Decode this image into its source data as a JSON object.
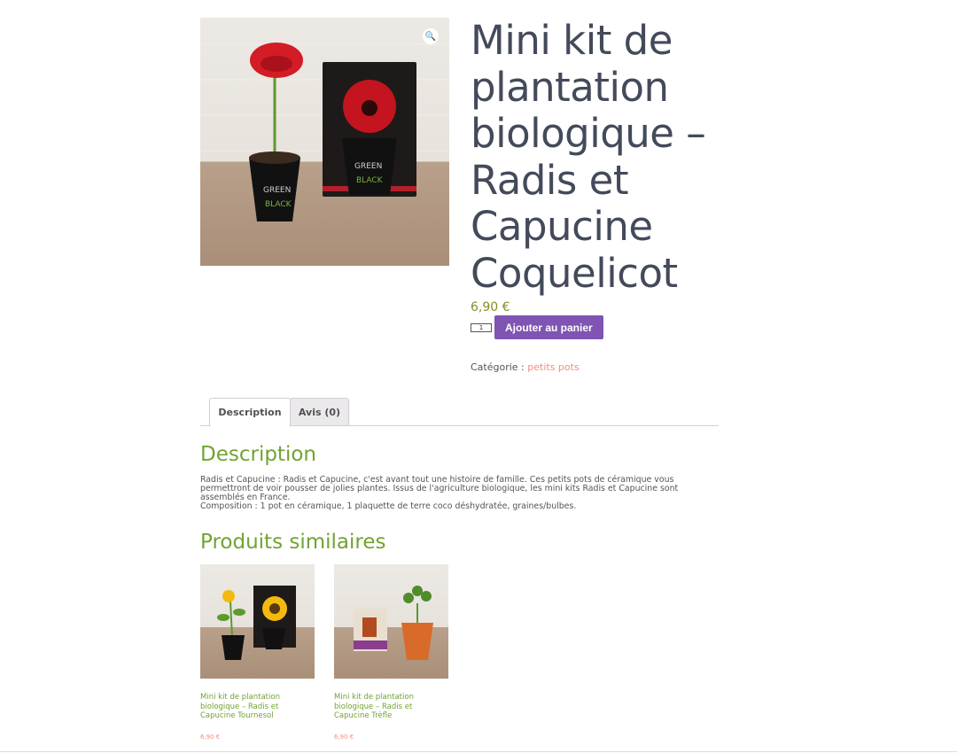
{
  "product": {
    "title": "Mini kit de plantation biologique – Radis et Capucine Coquelicot",
    "price": "6,90 €",
    "quantity": "1",
    "add_to_cart_label": "Ajouter au panier",
    "category_label": "Catégorie :",
    "category_value": "petits pots"
  },
  "gallery": {
    "zoom_icon": "🔍"
  },
  "tabs": [
    {
      "label": "Description"
    },
    {
      "label": "Avis (0)"
    }
  ],
  "description": {
    "heading": "Description",
    "line1": "Radis et Capucine : Radis et Capucine, c'est avant tout une histoire de famille. Ces petits pots de céramique vous permettront de voir pousser de jolies plantes. Issus de l'agriculture biologique, les mini kits Radis et Capucine sont assemblés en France.",
    "line2": "Composition : 1 pot en céramique, 1 plaquette de terre coco déshydratée, graines/bulbes."
  },
  "related": {
    "heading": "Produits similaires",
    "items": [
      {
        "name": "Mini kit de plantation biologique – Radis et Capucine Tournesol",
        "price": "6,90 €"
      },
      {
        "name": "Mini kit de plantation biologique – Radis et Capucine Trèfle",
        "price": "6,90 €"
      }
    ]
  },
  "colors": {
    "accent_green": "#71a332",
    "button_purple": "#7f54b3",
    "link_salmon": "#f08f80",
    "title_slate": "#434a5a"
  }
}
